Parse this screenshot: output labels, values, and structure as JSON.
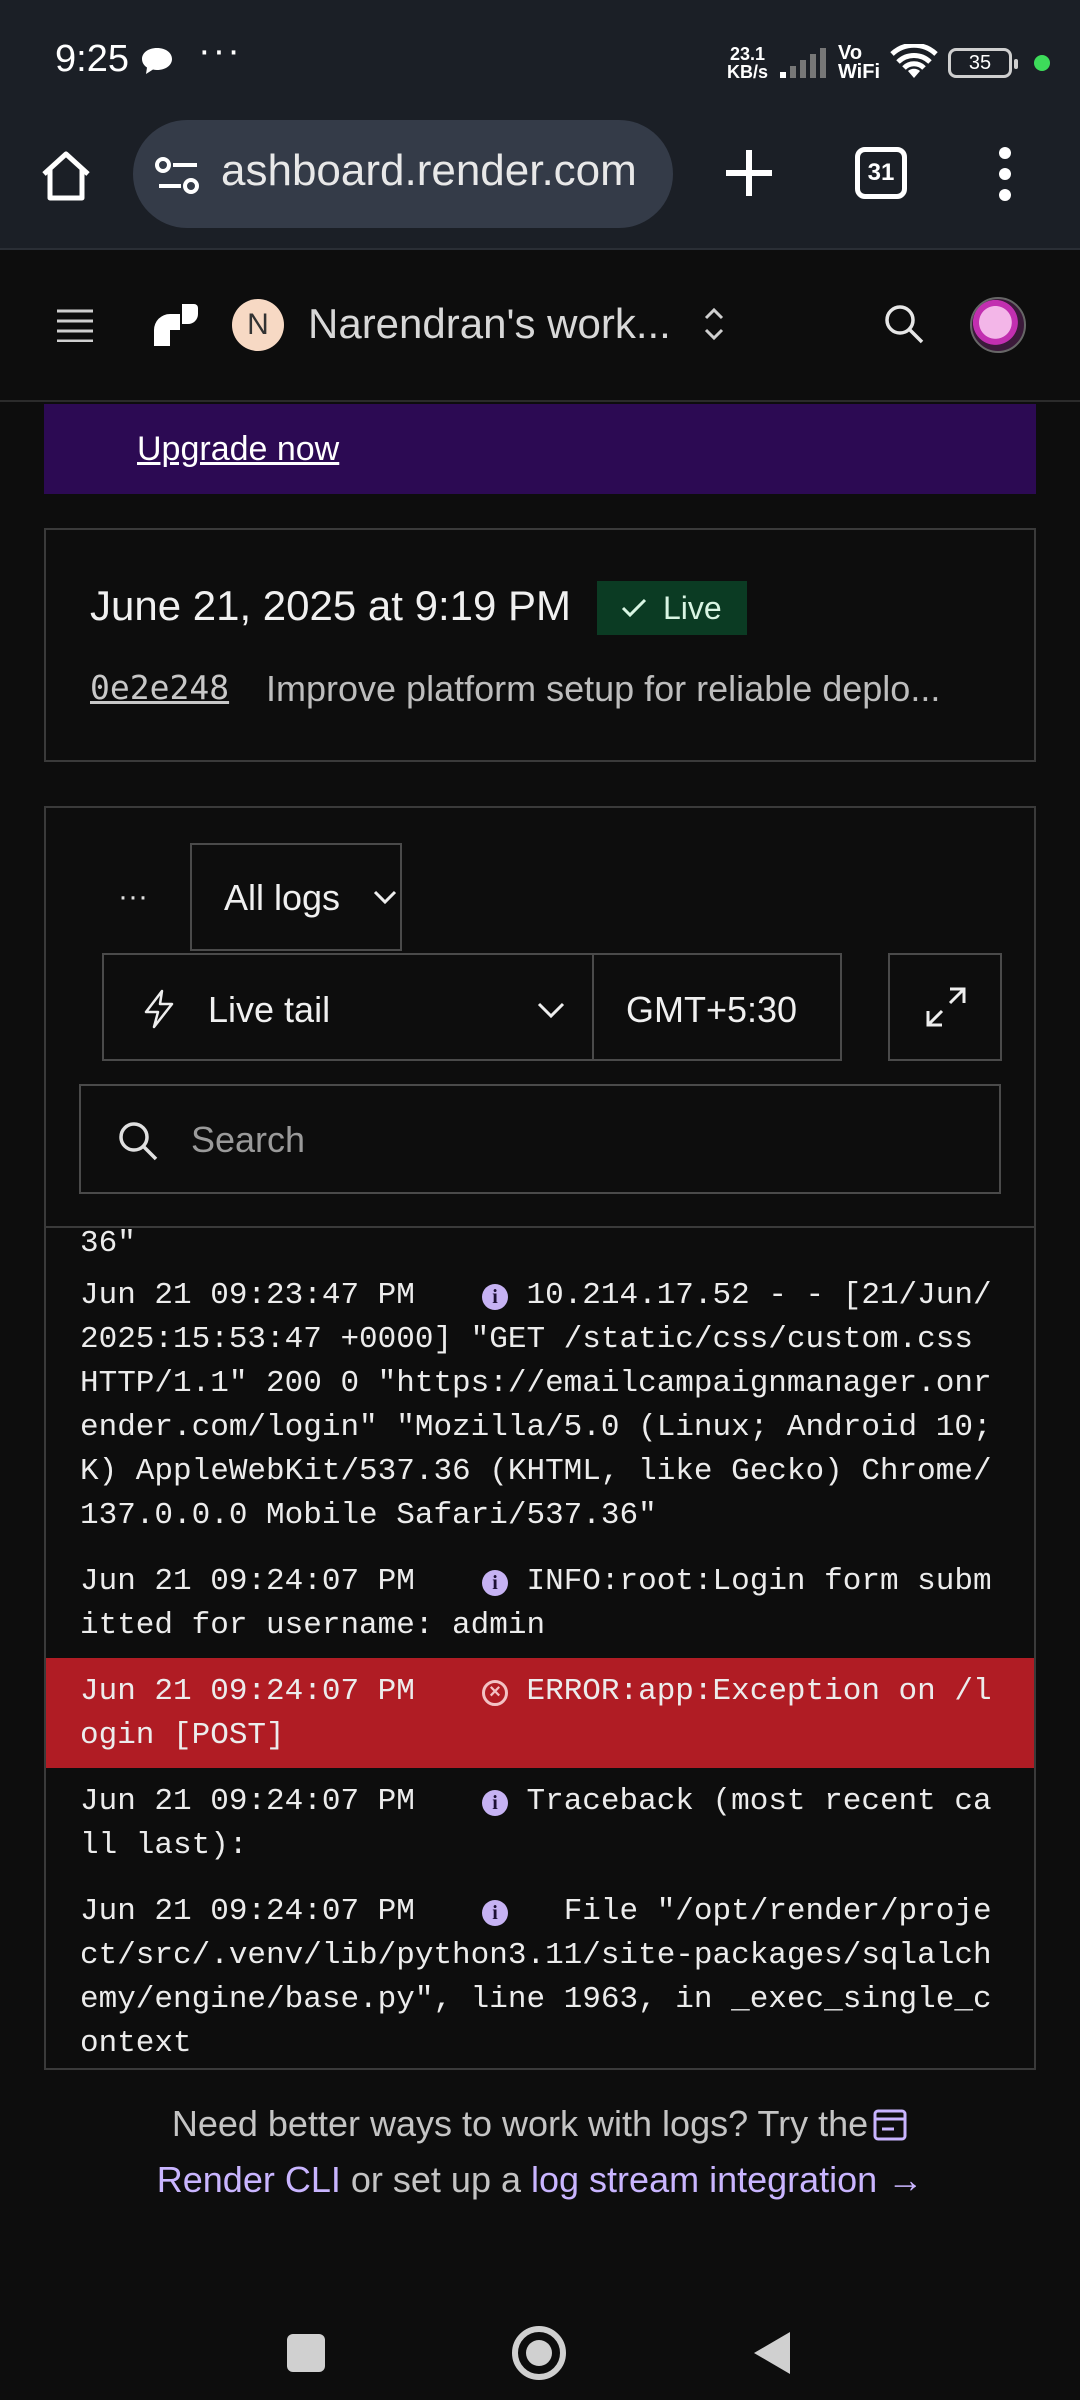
{
  "status": {
    "time": "9:25",
    "net_speed": "23.1",
    "net_unit": "KB/s",
    "vowifi_top": "Vo",
    "vowifi_bottom": "WiFi",
    "battery": "35"
  },
  "browser": {
    "url": "ashboard.render.com",
    "tab_count": "31"
  },
  "header": {
    "workspace_initial": "N",
    "workspace_name": "Narendran's work..."
  },
  "banner": {
    "upgrade_label": "Upgrade now"
  },
  "deploy": {
    "date": "June 21, 2025 at 9:19 PM",
    "status": "Live",
    "commit_hash": "0e2e248",
    "commit_message": "Improve platform setup for reliable deplo..."
  },
  "logs": {
    "filter": "All logs",
    "mode": "Live tail",
    "timezone": "GMT+5:30",
    "search_placeholder": "Search",
    "fragment": "36\"",
    "lines": [
      {
        "timestamp": "Jun 21 09:23:47 PM",
        "level": "info",
        "message": "10.214.17.52 - - [21/Jun/2025:15:53:47 +0000] \"GET /static/css/custom.css HTTP/1.1\" 200 0 \"https://emailcampaignmanager.onrender.com/login\" \"Mozilla/5.0 (Linux; Android 10; K) AppleWebKit/537.36 (KHTML, like Gecko) Chrome/137.0.0.0 Mobile Safari/537.36\""
      },
      {
        "timestamp": "Jun 21 09:24:07 PM",
        "level": "info",
        "message": "INFO:root:Login form submitted for username: admin"
      },
      {
        "timestamp": "Jun 21 09:24:07 PM",
        "level": "error",
        "message": "ERROR:app:Exception on /login [POST]"
      },
      {
        "timestamp": "Jun 21 09:24:07 PM",
        "level": "info",
        "message": "Traceback (most recent call last):"
      },
      {
        "timestamp": "Jun 21 09:24:07 PM",
        "level": "info",
        "message": "  File \"/opt/render/project/src/.venv/lib/python3.11/site-packages/sqlalchemy/engine/base.py\", line 1963, in _exec_single_context"
      }
    ]
  },
  "footer": {
    "text_before": "Need better ways to work with logs? Try the",
    "cli_link": "Render CLI",
    "text_middle": "or set up a",
    "integration_link": "log stream integration",
    "arrow": "→"
  }
}
